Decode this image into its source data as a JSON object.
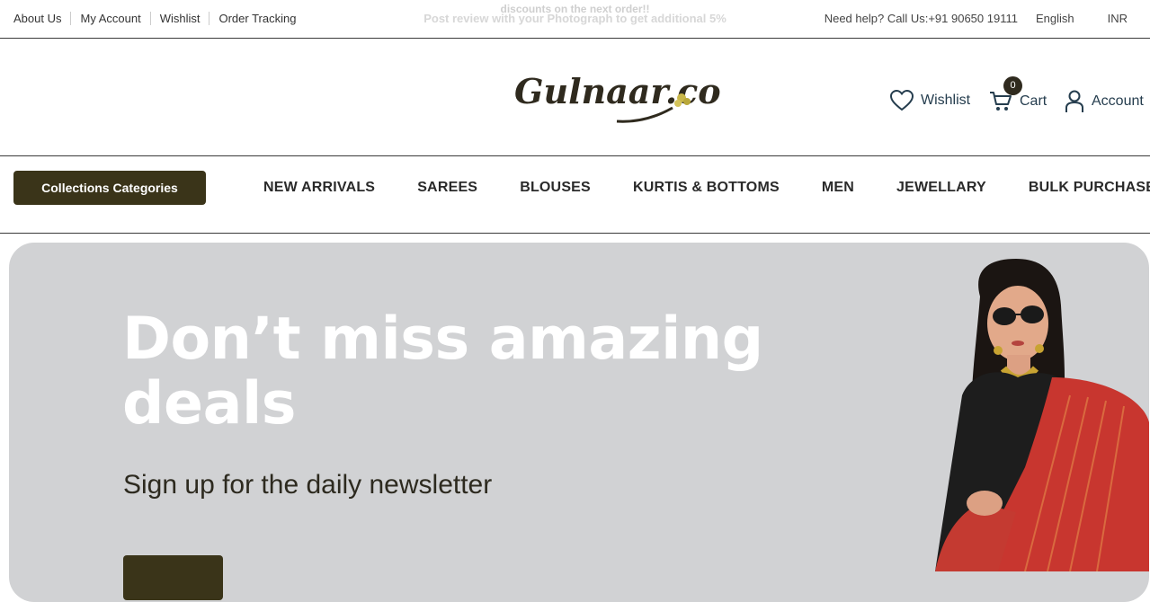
{
  "topbar": {
    "links": [
      "About Us",
      "My Account",
      "Wishlist",
      "Order Tracking"
    ],
    "promo_line1": "discounts on the next order!!",
    "promo_line2": "Post review with your Photograph to get additional 5%",
    "help": "Need help? Call Us:+91 90650 19111",
    "language": "English",
    "currency": "INR"
  },
  "header": {
    "logo_text": "Gulnaar.co",
    "wishlist_label": "Wishlist",
    "cart_label": "Cart",
    "cart_count": "0",
    "account_label": "Account"
  },
  "nav": {
    "categories_button": "Collections Categories",
    "items": [
      "NEW ARRIVALS",
      "SAREES",
      "BLOUSES",
      "KURTIS & BOTTOMS",
      "MEN",
      "JEWELLARY",
      "BULK PURCHASE"
    ]
  },
  "hero": {
    "title": "Don’t miss amazing deals",
    "subtitle": "Sign up for the daily newsletter"
  },
  "colors": {
    "brand_dark": "#3a3419",
    "hero_bg": "#d1d2d4",
    "text_main": "#253d4e"
  },
  "icons": [
    "heart-icon",
    "cart-icon",
    "user-icon"
  ]
}
